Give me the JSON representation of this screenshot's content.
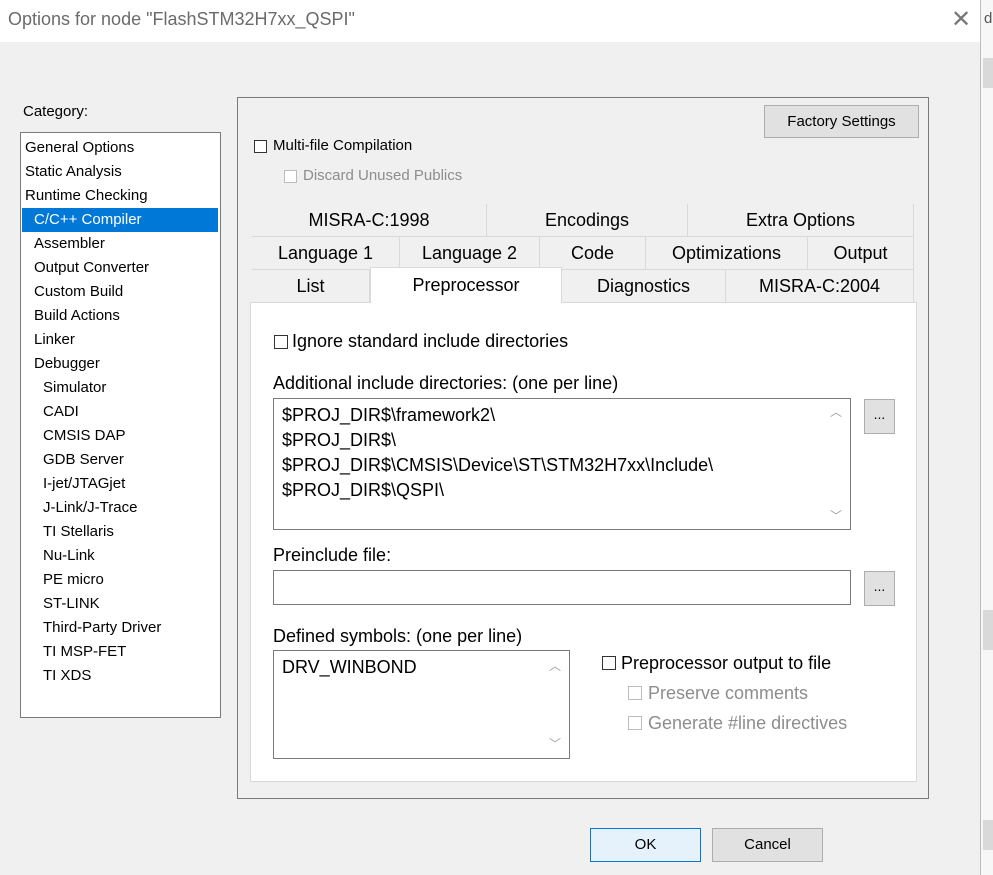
{
  "window": {
    "title": "Options for node \"FlashSTM32H7xx_QSPI\"",
    "close_glyph": "✕",
    "edge_letter": "d"
  },
  "category": {
    "label": "Category:",
    "items": [
      {
        "label": "General Options",
        "indent": 0
      },
      {
        "label": "Static Analysis",
        "indent": 0
      },
      {
        "label": "Runtime Checking",
        "indent": 0
      },
      {
        "label": "C/C++ Compiler",
        "indent": 1,
        "selected": true
      },
      {
        "label": "Assembler",
        "indent": 1
      },
      {
        "label": "Output Converter",
        "indent": 1
      },
      {
        "label": "Custom Build",
        "indent": 1
      },
      {
        "label": "Build Actions",
        "indent": 1
      },
      {
        "label": "Linker",
        "indent": 1
      },
      {
        "label": "Debugger",
        "indent": 1
      },
      {
        "label": "Simulator",
        "indent": 2
      },
      {
        "label": "CADI",
        "indent": 2
      },
      {
        "label": "CMSIS DAP",
        "indent": 2
      },
      {
        "label": "GDB Server",
        "indent": 2
      },
      {
        "label": "I-jet/JTAGjet",
        "indent": 2
      },
      {
        "label": "J-Link/J-Trace",
        "indent": 2
      },
      {
        "label": "TI Stellaris",
        "indent": 2
      },
      {
        "label": "Nu-Link",
        "indent": 2
      },
      {
        "label": "PE micro",
        "indent": 2
      },
      {
        "label": "ST-LINK",
        "indent": 2
      },
      {
        "label": "Third-Party Driver",
        "indent": 2
      },
      {
        "label": "TI MSP-FET",
        "indent": 2
      },
      {
        "label": "TI XDS",
        "indent": 2
      }
    ]
  },
  "options": {
    "factory_settings": "Factory Settings",
    "multifile_label": "Multi-file Compilation",
    "multifile_checked": false,
    "discard_label": "Discard Unused Publics",
    "discard_checked": false
  },
  "tabs": {
    "row1": [
      "MISRA-C:1998",
      "Encodings",
      "Extra Options"
    ],
    "row2": [
      "Language 1",
      "Language 2",
      "Code",
      "Optimizations",
      "Output"
    ],
    "row3": [
      "List",
      "Preprocessor",
      "Diagnostics",
      "MISRA-C:2004"
    ],
    "active": "Preprocessor"
  },
  "preprocessor": {
    "ignore_std_label": "Ignore standard include directories",
    "ignore_std_checked": false,
    "include_dirs_label": "Additional include directories: (one per line)",
    "include_dirs": [
      "$PROJ_DIR$\\framework2\\",
      "$PROJ_DIR$\\",
      "$PROJ_DIR$\\CMSIS\\Device\\ST\\STM32H7xx\\Include\\",
      "$PROJ_DIR$\\QSPI\\"
    ],
    "browse_label": "...",
    "preinclude_label": "Preinclude file:",
    "preinclude_value": "",
    "defined_symbols_label": "Defined symbols: (one per line)",
    "defined_symbols": [
      "DRV_WINBOND"
    ],
    "pp_output_label": "Preprocessor output to file",
    "pp_output_checked": false,
    "preserve_comments_label": "Preserve comments",
    "generate_line_label": "Generate #line directives"
  },
  "footer": {
    "ok_label": "OK",
    "cancel_label": "Cancel"
  }
}
